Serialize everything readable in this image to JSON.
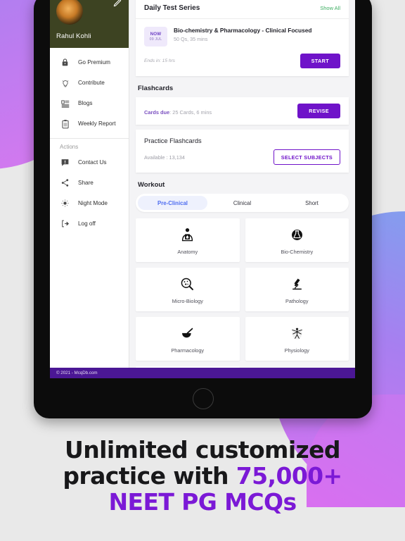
{
  "tablet": {
    "home_button": "home-button"
  },
  "sidebar": {
    "profile": {
      "name": "Rahul Kohli",
      "edit_icon": "pencil-edit-icon",
      "avatar": "user-avatar"
    },
    "primary_items": [
      {
        "label": "Go Premium",
        "icon": "lock-icon"
      },
      {
        "label": "Contribute",
        "icon": "lightbulb-icon"
      },
      {
        "label": "Blogs",
        "icon": "article-list-icon"
      },
      {
        "label": "Weekly Report",
        "icon": "clipboard-icon"
      }
    ],
    "actions_label": "Actions",
    "action_items": [
      {
        "label": "Contact Us",
        "icon": "message-icon"
      },
      {
        "label": "Share",
        "icon": "share-icon"
      },
      {
        "label": "Night Mode",
        "icon": "brightness-icon"
      },
      {
        "label": "Log off",
        "icon": "logout-icon"
      }
    ]
  },
  "main": {
    "daily_test_series": {
      "title": "Daily Test Series",
      "show_all": "Show All",
      "badge_now": "NOW",
      "badge_date": "09 JUL",
      "test_name": "Bio-chemistry & Pharmacology - Clinical Focused",
      "test_meta": "50 Qs, 35 mins",
      "ends_in": "Ends in: 15 hrs",
      "start_button": "START"
    },
    "flashcards": {
      "heading": "Flashcards",
      "cards_due_label": "Cards due",
      "cards_due_value": ": 25 Cards, 6 mins",
      "revise_button": "REVISE",
      "practice_title": "Practice Flashcards",
      "available": "Available : 13,134",
      "select_subjects_button": "SELECT SUBJECTS"
    },
    "workout": {
      "heading": "Workout",
      "tabs": [
        {
          "label": "Pre-Clinical",
          "active": true
        },
        {
          "label": "Clinical",
          "active": false
        },
        {
          "label": "Short",
          "active": false
        }
      ],
      "subjects": [
        {
          "label": "Anatomy",
          "icon": "anatomy-torso-icon"
        },
        {
          "label": "Bio-Chemistry",
          "icon": "flask-circle-icon"
        },
        {
          "label": "Micro-Biology",
          "icon": "microbe-magnifier-icon"
        },
        {
          "label": "Pathology",
          "icon": "microscope-icon"
        },
        {
          "label": "Pharmacology",
          "icon": "mortar-pestle-icon"
        },
        {
          "label": "Physiology",
          "icon": "vitruvian-body-icon"
        },
        {
          "label": "",
          "icon": "community-people-icon"
        }
      ]
    }
  },
  "footer": {
    "copyright": "© 2021 - McqDb.com"
  },
  "caption": {
    "line1": "Unlimited customized",
    "line2_plain": "practice with ",
    "line2_accent": "75,000+",
    "line3_accent": "NEET PG MCQs"
  },
  "colors": {
    "brand_purple": "#6f13c9",
    "footer_purple": "#4b1795",
    "profile_olive": "#3d4322",
    "link_green": "#3fae63",
    "tab_blue": "#4d6cf0",
    "caption_accent": "#7b19d6"
  }
}
